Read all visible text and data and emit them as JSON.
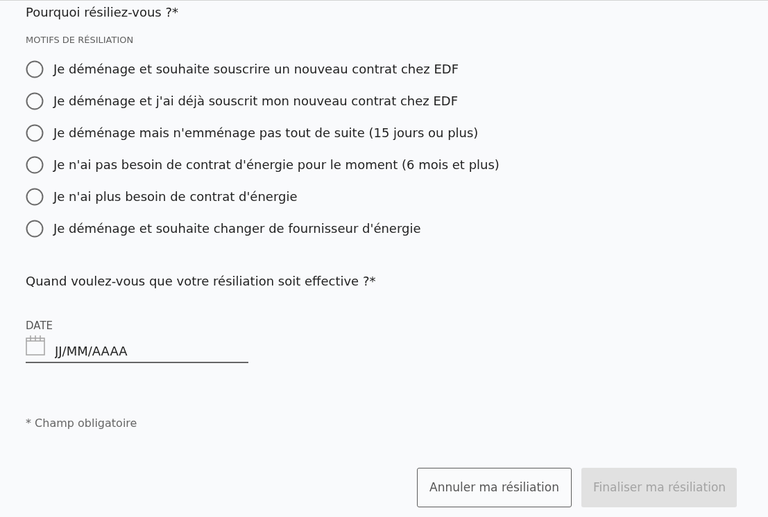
{
  "reason_question": {
    "title": "Pourquoi résiliez-vous ?*"
  },
  "reasons": {
    "label": "MOTIFS DE RÉSILIATION",
    "options": [
      {
        "label": "Je déménage et souhaite souscrire un nouveau contrat chez EDF",
        "selected": false
      },
      {
        "label": "Je déménage et j'ai déjà souscrit mon nouveau contrat chez EDF",
        "selected": false
      },
      {
        "label": "Je déménage mais n'emménage pas tout de suite (15 jours ou plus)",
        "selected": false
      },
      {
        "label": "Je n'ai pas besoin de contrat d'énergie pour le moment (6 mois et plus)",
        "selected": false
      },
      {
        "label": "Je n'ai plus besoin de contrat d'énergie",
        "selected": false
      },
      {
        "label": "Je déménage et souhaite changer de fournisseur d'énergie",
        "selected": false
      }
    ]
  },
  "date_question": {
    "title": "Quand voulez-vous que votre résiliation soit effective ?*"
  },
  "date_field": {
    "label": "DATE",
    "placeholder": "JJ/MM/AAAA"
  },
  "required_note": "* Champ obligatoire",
  "buttons": [
    {
      "label": "Annuler ma résiliation",
      "kind": "secondary",
      "disabled": false
    },
    {
      "label": "Finaliser ma résiliation",
      "kind": "primary",
      "disabled": true
    }
  ]
}
